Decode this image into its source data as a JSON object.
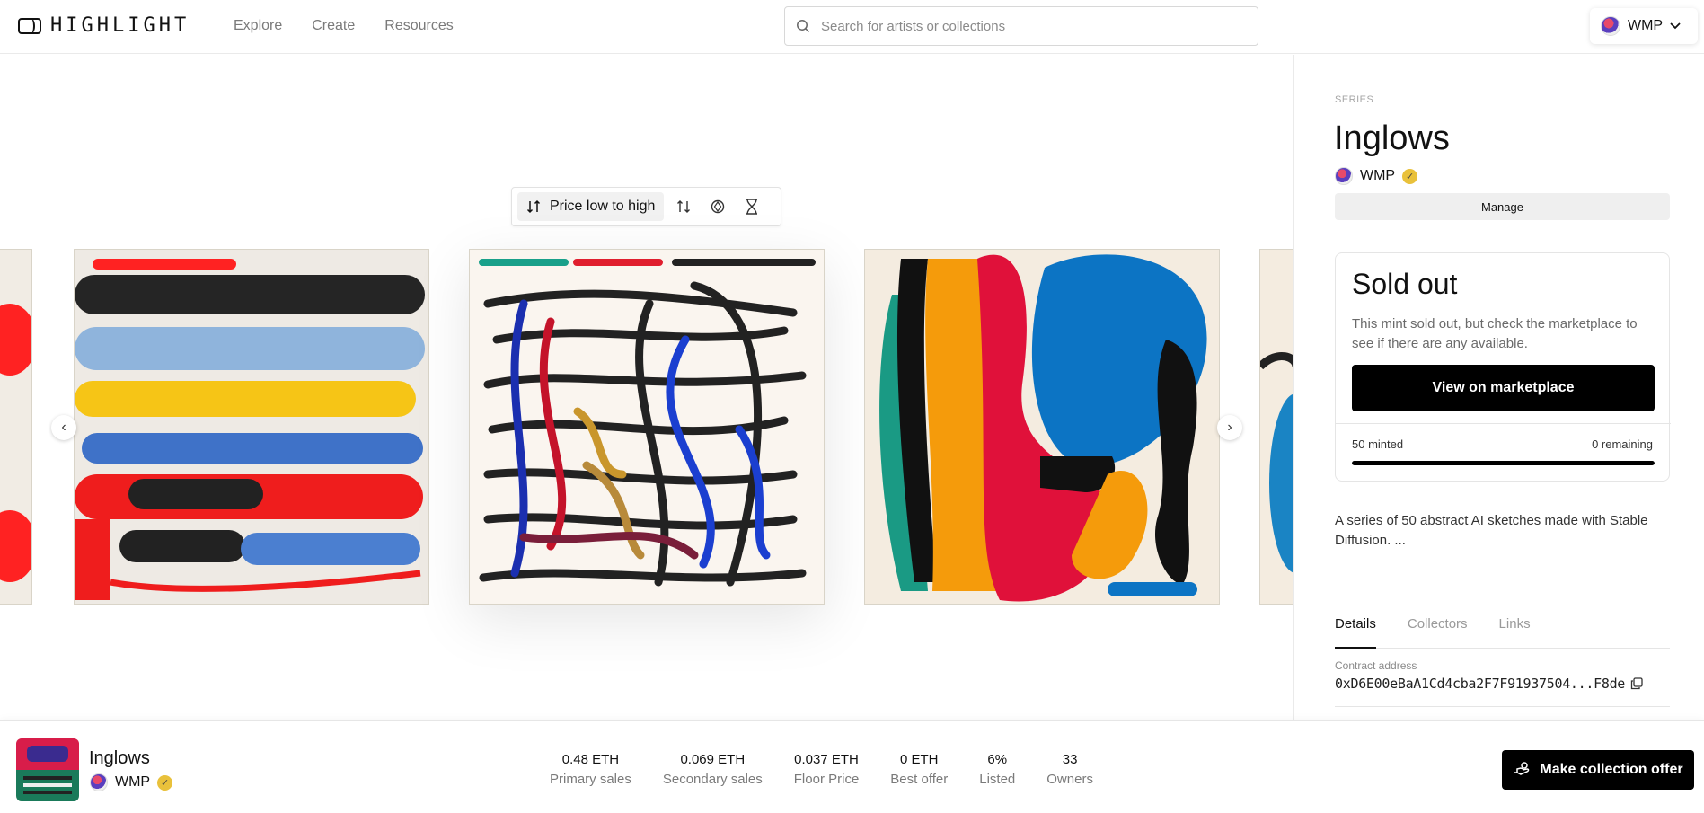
{
  "header": {
    "logo_text": "HIGHLIGHT",
    "nav": [
      "Explore",
      "Create",
      "Resources"
    ],
    "search_placeholder": "Search for artists or collections",
    "user_name": "WMP"
  },
  "gallery": {
    "sort_label": "Price low to high",
    "sort_icons": [
      "sort-direction-icon",
      "chain-filter-icon",
      "hourglass-icon"
    ],
    "prev_label": "‹",
    "next_label": "›"
  },
  "sidebar": {
    "series_label": "SERIES",
    "title": "Inglows",
    "creator": "WMP",
    "manage_label": "Manage",
    "status_title": "Sold out",
    "status_note": "This mint sold out, but check the marketplace to see if there are any available.",
    "marketplace_label": "View on marketplace",
    "minted_text": "50 minted",
    "remaining_text": "0 remaining",
    "mint_progress": 1.0,
    "description": "A series of 50 abstract AI sketches made with Stable Diffusion. ...",
    "tabs": [
      "Details",
      "Collectors",
      "Links"
    ],
    "active_tab": "Details",
    "contract_label": "Contract address",
    "contract_address": "0xD6E00eBaA1Cd4cba2F7F91937504...F8de"
  },
  "bottom": {
    "name": "Inglows",
    "creator": "WMP",
    "stats": [
      {
        "value": "0.48 ETH",
        "label": "Primary sales"
      },
      {
        "value": "0.069 ETH",
        "label": "Secondary sales"
      },
      {
        "value": "0.037 ETH",
        "label": "Floor Price"
      },
      {
        "value": "0 ETH",
        "label": "Best offer"
      },
      {
        "value": "6%",
        "label": "Listed"
      },
      {
        "value": "33",
        "label": "Owners"
      }
    ],
    "offer_label": "Make collection offer"
  },
  "colors": {
    "primary_button": "#000000",
    "verified_badge": "#e9c13b",
    "muted_text": "#7a7a7a"
  }
}
